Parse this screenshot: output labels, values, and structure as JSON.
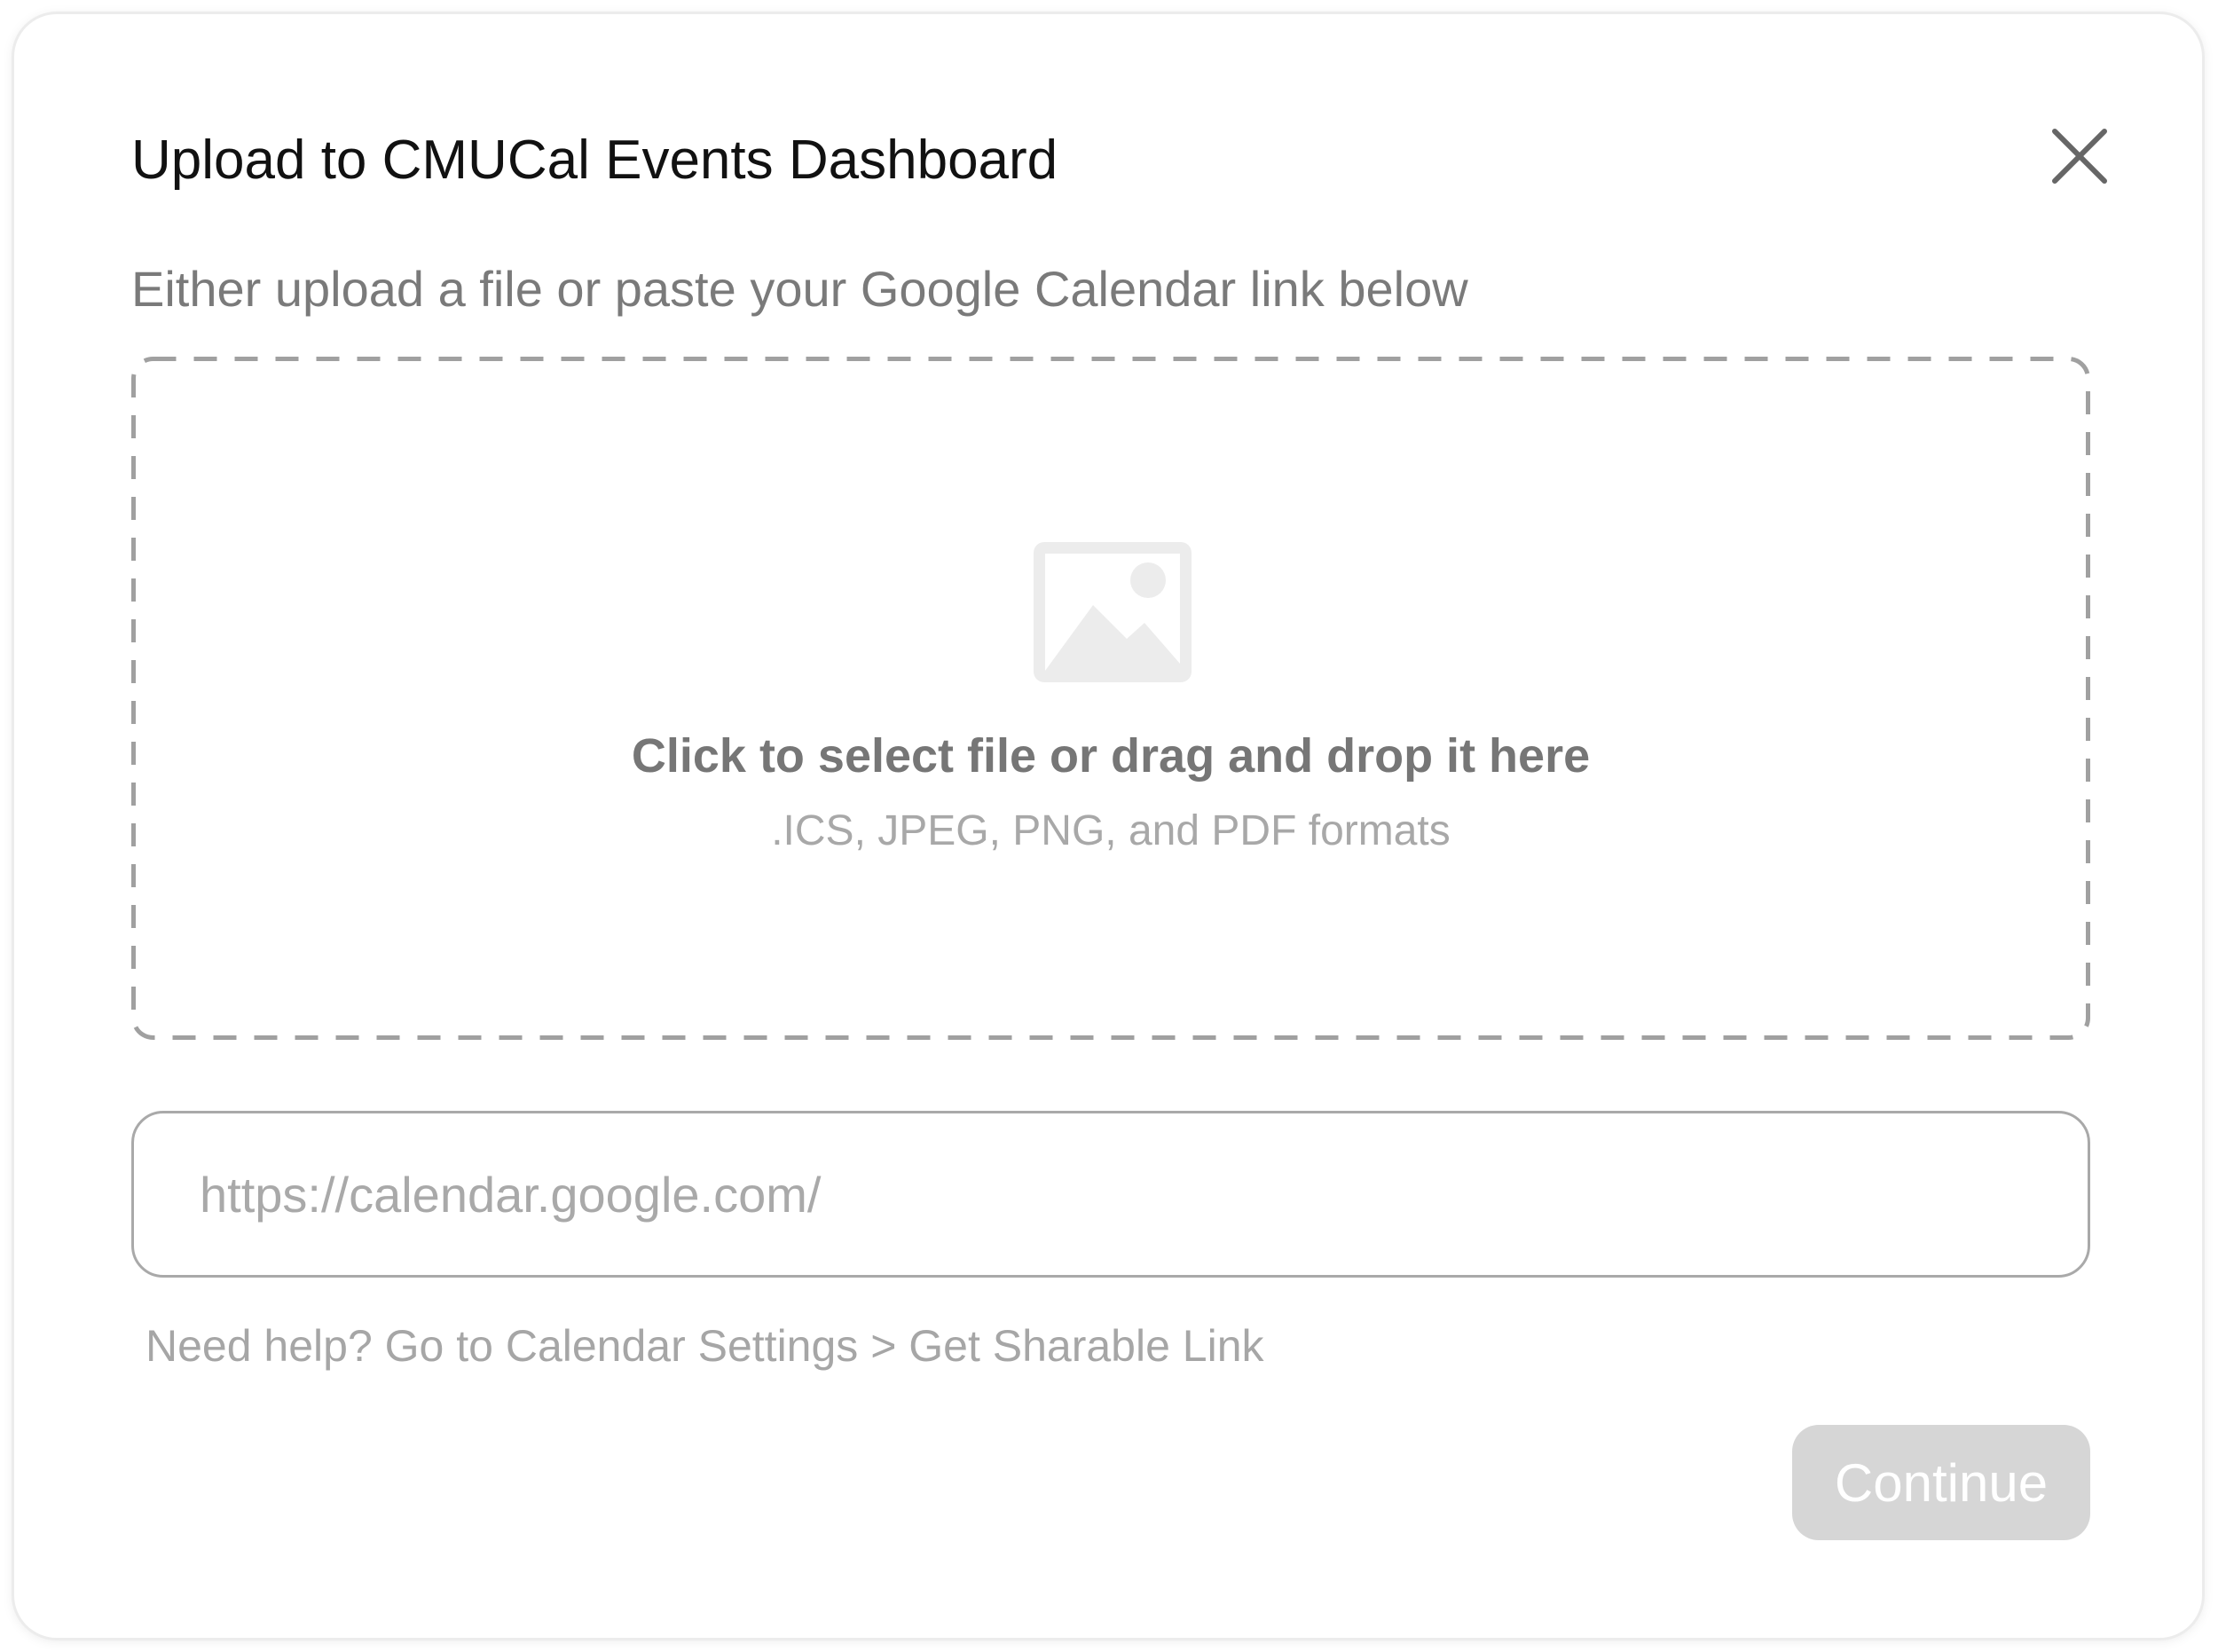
{
  "modal": {
    "title": "Upload to CMUCal Events Dashboard",
    "subtitle": "Either upload a file or paste your Google Calendar link below",
    "close_icon": "close-icon"
  },
  "dropzone": {
    "icon": "image-icon",
    "main_text": "Click to select file or drag and drop it here",
    "formats_text": ".ICS, JPEG, PNG, and PDF formats"
  },
  "link_input": {
    "value": "",
    "placeholder": "https://calendar.google.com/"
  },
  "help_text": "Need help? Go to Calendar Settings > Get Sharable Link",
  "continue_button": {
    "label": "Continue",
    "state": "disabled"
  },
  "colors": {
    "title_text": "#111111",
    "muted_text": "#7a7a7a",
    "placeholder_text": "#a9a9a9",
    "dashed_border": "#a0a0a0",
    "icon_fill": "#ececec",
    "button_disabled_bg": "#d6d6d6",
    "button_text": "#ffffff"
  }
}
